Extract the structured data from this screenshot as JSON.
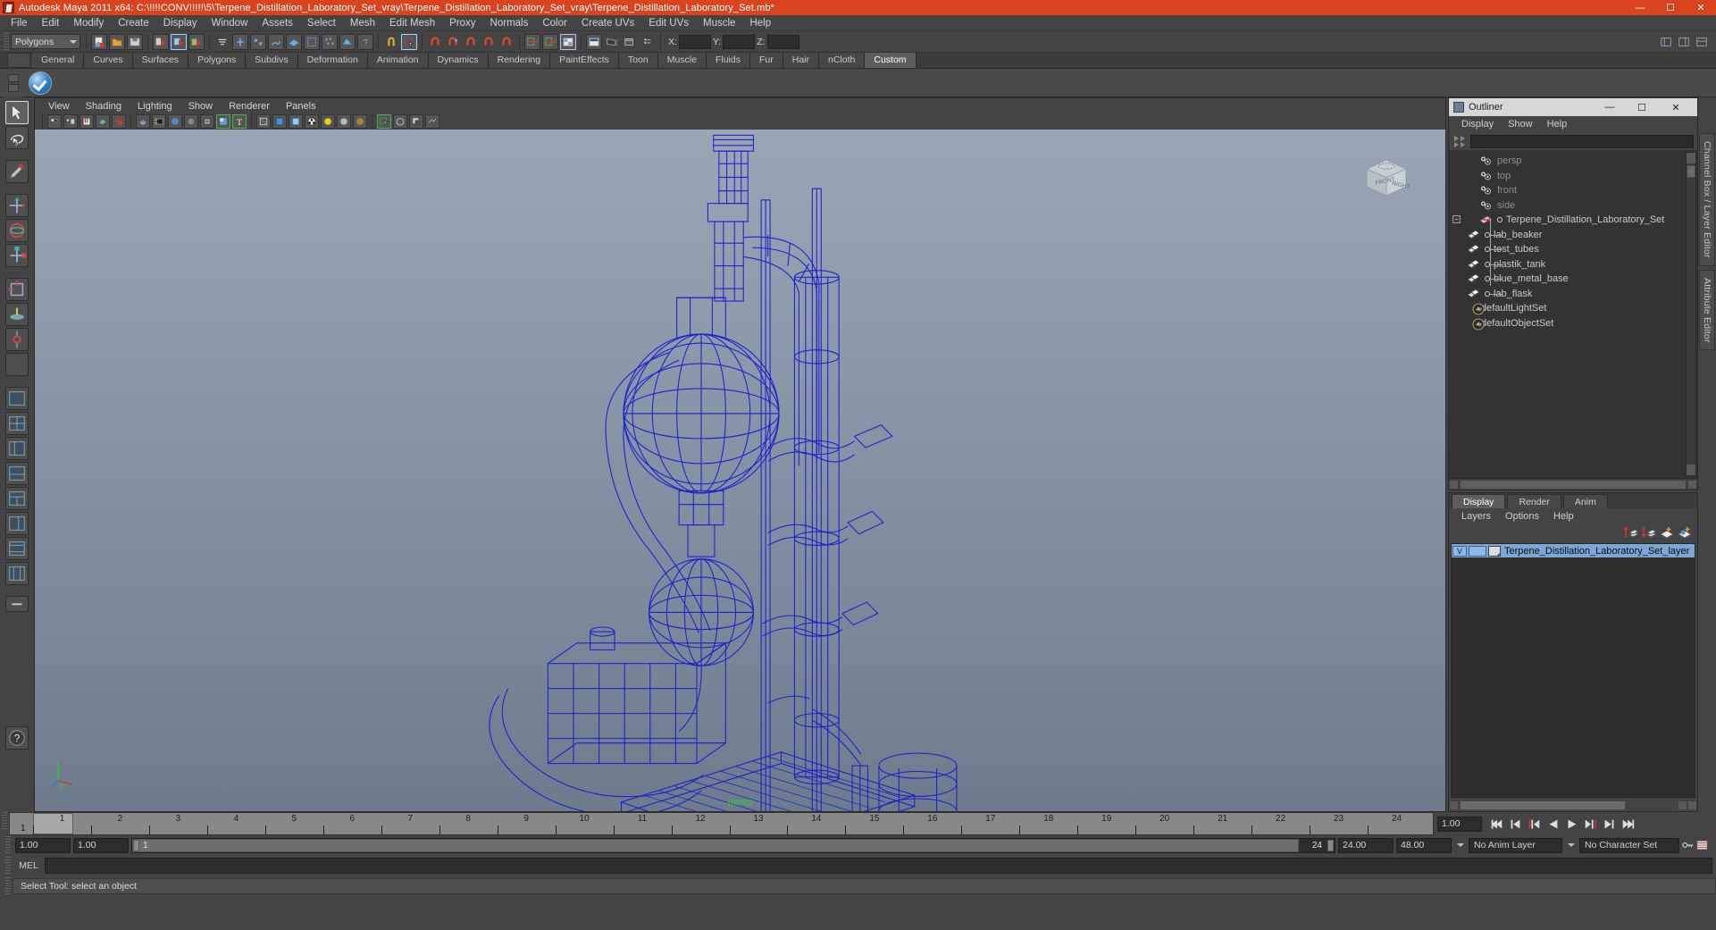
{
  "window": {
    "title": "Autodesk Maya 2011 x64: C:\\!!!!CONV!!!!!\\5\\Terpene_Distillation_Laboratory_Set_vray\\Terpene_Distillation_Laboratory_Set_vray\\Terpene_Distillation_Laboratory_Set.mb*",
    "minimize": "—",
    "maximize": "☐",
    "close": "✕",
    "titlebar_color": "#d9441f"
  },
  "menubar": {
    "items": [
      "File",
      "Edit",
      "Modify",
      "Create",
      "Display",
      "Window",
      "Assets",
      "Select",
      "Mesh",
      "Edit Mesh",
      "Proxy",
      "Normals",
      "Color",
      "Create UVs",
      "Edit UVs",
      "Muscle",
      "Help"
    ]
  },
  "statusline": {
    "menuset": "Polygons",
    "coord_labels": [
      "X:",
      "Y:",
      "Z:"
    ],
    "coord_values": [
      "",
      "",
      ""
    ]
  },
  "shelf": {
    "tabs": [
      "General",
      "Curves",
      "Surfaces",
      "Polygons",
      "Subdivs",
      "Deformation",
      "Animation",
      "Dynamics",
      "Rendering",
      "PaintEffects",
      "Toon",
      "Muscle",
      "Fluids",
      "Fur",
      "Hair",
      "nCloth",
      "Custom"
    ],
    "active_tab": "Custom"
  },
  "viewport": {
    "menu": [
      "View",
      "Shading",
      "Lighting",
      "Show",
      "Renderer",
      "Panels"
    ],
    "camera_label": "persp",
    "view_cube": {
      "front": "FRONT",
      "right": "RIGHT"
    },
    "axis": {
      "y": "y"
    },
    "background_top": "#9aa6b5",
    "background_bottom": "#6e7b8d",
    "wireframe_color": "#1a1ad0"
  },
  "outliner": {
    "title": "Outliner",
    "window_buttons": {
      "minimize": "—",
      "maximize": "☐",
      "close": "✕"
    },
    "menu": [
      "Display",
      "Show",
      "Help"
    ],
    "search_value": "",
    "items": [
      {
        "label": "persp",
        "type": "camera",
        "dim": true,
        "indent": 1
      },
      {
        "label": "top",
        "type": "camera",
        "dim": true,
        "indent": 1
      },
      {
        "label": "front",
        "type": "camera",
        "dim": true,
        "indent": 1
      },
      {
        "label": "side",
        "type": "camera",
        "dim": true,
        "indent": 1
      },
      {
        "label": "Terpene_Distillation_Laboratory_Set",
        "type": "group",
        "dim": false,
        "indent": 1,
        "expanded": true
      },
      {
        "label": "lab_beaker",
        "type": "mesh",
        "dim": false,
        "indent": 2
      },
      {
        "label": "test_tubes",
        "type": "mesh",
        "dim": false,
        "indent": 2
      },
      {
        "label": "plastik_tank",
        "type": "mesh",
        "dim": false,
        "indent": 2
      },
      {
        "label": "blue_metal_base",
        "type": "mesh",
        "dim": false,
        "indent": 2
      },
      {
        "label": "lab_flask",
        "type": "mesh",
        "dim": false,
        "indent": 2
      },
      {
        "label": "defaultLightSet",
        "type": "set",
        "dim": false,
        "indent": 1
      },
      {
        "label": "defaultObjectSet",
        "type": "set",
        "dim": false,
        "indent": 1
      }
    ]
  },
  "side_tabs": {
    "items": [
      "Channel Box / Layer Editor",
      "Attribute Editor"
    ]
  },
  "layer_editor": {
    "tabs": [
      "Display",
      "Render",
      "Anim"
    ],
    "active_tab": "Display",
    "menu": [
      "Layers",
      "Options",
      "Help"
    ],
    "layers": [
      {
        "visible": "V",
        "shading": "",
        "name": "Terpene_Distillation_Laboratory_Set_layer",
        "selected": true
      }
    ]
  },
  "timeline": {
    "ticks": [
      "1",
      "2",
      "3",
      "4",
      "5",
      "6",
      "7",
      "8",
      "9",
      "10",
      "11",
      "12",
      "13",
      "14",
      "15",
      "16",
      "17",
      "18",
      "19",
      "20",
      "21",
      "22",
      "23",
      "24"
    ],
    "current_frame_label": "1",
    "current_frame_value": "1.00",
    "range_start": "1.00",
    "range_end": "1.00",
    "range_bar_start": "1",
    "range_bar_end": "24",
    "anim_end": "24.00",
    "playback_end": "48.00",
    "anim_layer": "No Anim Layer",
    "character_set": "No Character Set"
  },
  "command_line": {
    "label": "MEL",
    "value": ""
  },
  "help_line": {
    "text": "Select Tool: select an object"
  }
}
